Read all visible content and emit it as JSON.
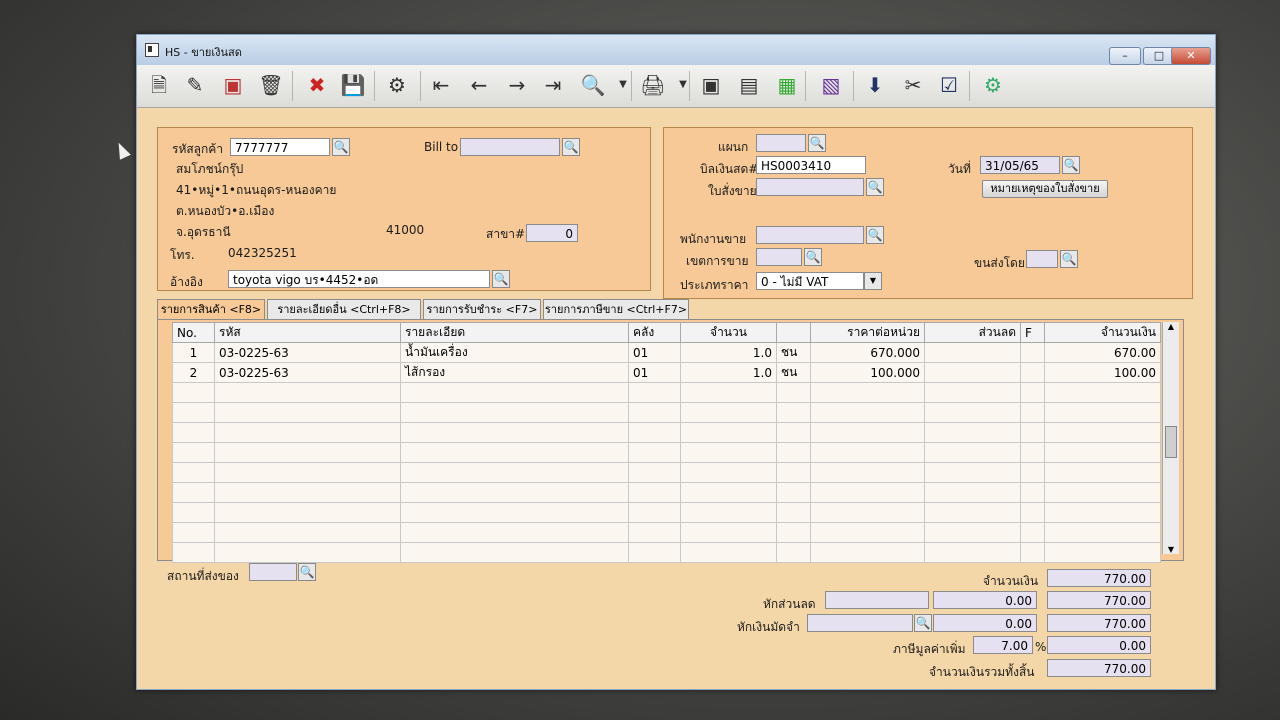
{
  "window": {
    "title": "HS - ขายเงินสด"
  },
  "toolbar": {
    "buttons": [
      "new-icon",
      "edit-icon",
      "delete-icon",
      "trash-icon",
      "cancel-icon",
      "save-icon",
      "search-icon",
      "first-icon",
      "prev-icon",
      "next-icon",
      "last-icon",
      "preview-icon",
      "print-icon",
      "print-doc-icon",
      "export-icon",
      "report-icon",
      "stock-icon",
      "download-ok-icon",
      "tools-icon",
      "confirm-ok-icon",
      "settings-icon"
    ]
  },
  "customer": {
    "code_label": "รหัสลูกค้า",
    "code": "7777777",
    "bill_to_label": "Bill to",
    "name": "สมโภชน์กรุ๊ป",
    "addr1": "41•หมู่•1•ถนนอุดร-หนองคาย",
    "addr2": "ต.หนองบัว•อ.เมือง",
    "addr3": "จ.อุดรธานี",
    "postcode": "41000",
    "branch_label": "สาขา#",
    "branch": "0",
    "phone_label": "โทร.",
    "phone": "042325251",
    "ref_label": "อ้างอิง",
    "ref": "toyota vigo บร•4452•อด"
  },
  "doc": {
    "dept_label": "แผนก",
    "bill_label": "บิลเงินสด#",
    "bill_no": "HS0003410",
    "date_label": "วันที่",
    "date": "31/05/65",
    "order_label": "ใบสั่งขาย",
    "note_button": "หมายเหตุของใบสั่งขาย",
    "salesman_label": "พนักงานขาย",
    "area_label": "เขตการขาย",
    "ship_label": "ขนส่งโดย",
    "price_type_label": "ประเภทราคา",
    "price_type": "0 - ไม่มี VAT"
  },
  "tabs": [
    "รายการสินค้า <F8>",
    "รายละเอียดอื่น <Ctrl+F8>",
    "รายการรับชำระ <F7>",
    "รายการภาษีขาย <Ctrl+F7>"
  ],
  "grid": {
    "headers": [
      "No.",
      "รหัส",
      "รายละเอียด",
      "คลัง",
      "จำนวน",
      "",
      "ราคาต่อหน่วย",
      "ส่วนลด",
      "F",
      "จำนวนเงิน"
    ],
    "rows": [
      [
        "1",
        "03-0225-63",
        "น้ำมันเครื่อง",
        "01",
        "1.0",
        "ชน",
        "670.000",
        "",
        "",
        "670.00"
      ],
      [
        "2",
        "03-0225-63",
        "ไส้กรอง",
        "01",
        "1.0",
        "ชน",
        "100.000",
        "",
        "",
        "100.00"
      ]
    ]
  },
  "footer": {
    "ship_place_label": "สถานที่ส่งของ",
    "amount_label": "จำนวนเงิน",
    "amount": "770.00",
    "discount_label": "หักส่วนลด",
    "discount": "0.00",
    "after_discount": "770.00",
    "deposit_label": "หักเงินมัดจำ",
    "deposit": "0.00",
    "after_deposit": "770.00",
    "vat_label": "ภาษีมูลค่าเพิ่ม",
    "vat_rate": "7.00",
    "vat_pct": "%",
    "vat_amount": "0.00",
    "total_label": "จำนวนเงินรวมทั้งสิ้น",
    "total": "770.00"
  }
}
